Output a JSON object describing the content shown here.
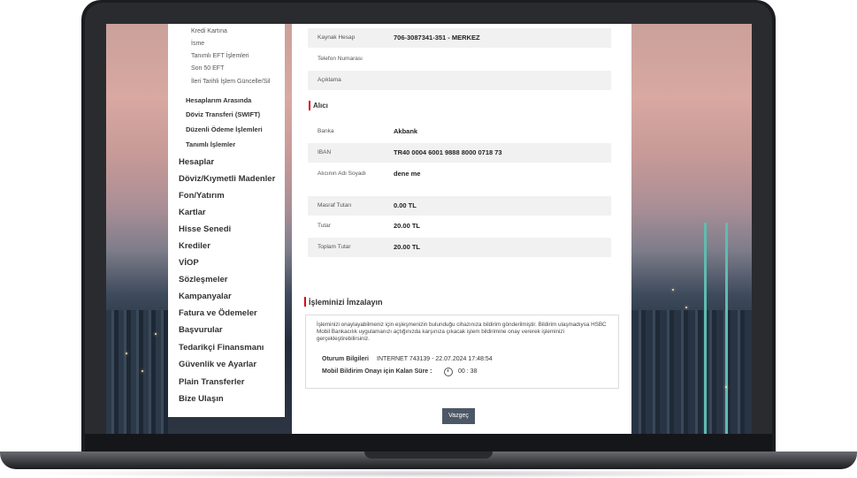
{
  "sidebar": {
    "sub_items": [
      "Kredi Kartına",
      "İsme",
      "Tanımlı EFT İşlemleri",
      "Son 50 EFT",
      "İleri Tarihli İşlem Güncelle/Sil"
    ],
    "group_items": [
      "Hesaplarım Arasında",
      "Döviz Transferi (SWIFT)",
      "Düzenli Ödeme İşlemleri",
      "Tanımlı İşlemler"
    ],
    "main_items": [
      "Hesaplar",
      "Döviz/Kıymetli Madenler",
      "Fon/Yatırım",
      "Kartlar",
      "Hisse Senedi",
      "Krediler",
      "VİOP",
      "Sözleşmeler",
      "Kampanyalar",
      "Fatura ve Ödemeler",
      "Başvurular",
      "Tedarikçi Finansmanı",
      "Güvenlik ve Ayarlar",
      "Plain Transferler",
      "Bize Ulaşın"
    ]
  },
  "sender": {
    "source_label": "Kaynak Hesap",
    "source_value": "706-3087341-351 - MERKEZ",
    "phone_label": "Telefon Numarası",
    "desc_label": "Açıklama"
  },
  "recipient": {
    "title": "Alıcı",
    "bank_label": "Banka",
    "bank_value": "Akbank",
    "iban_label": "IBAN",
    "iban_value": "TR40 0004 6001 9888 8000 0718 73",
    "name_label": "Alıcının Adı Soyadı",
    "name_value": "dene me"
  },
  "amounts": {
    "fee_label": "Masraf Tutarı",
    "fee_value": "0.00 TL",
    "amount_label": "Tutar",
    "amount_value": "20.00 TL",
    "total_label": "Toplam Tutar",
    "total_value": "20.00 TL"
  },
  "sign": {
    "title": "İşleminizi İmzalayın",
    "description": "İşleminizi onaylayabilmeniz için eşleşmenizin bulunduğu cihazınıza bildirim gönderilmiştir. Bildirim ulaşmadıysa HSBC Mobil Bankacılık uygulamanızı açtığınızda karşınıza çıkacak işlem bildirimine onay vererek işleminizi gerçekleştirebilirsiniz.",
    "session_label": "Oturum Bilgileri",
    "session_value": "INTERNET 743139 - 22.07.2024 17:48:54",
    "timer_label": "Mobil Bildirim Onayı için Kalan Süre :",
    "timer_value": "00 : 38"
  },
  "cancel_label": "Vazgeç",
  "icons": {
    "timer": "clock-icon"
  },
  "colors": {
    "accent": "#db0011",
    "button": "#4d5866"
  }
}
